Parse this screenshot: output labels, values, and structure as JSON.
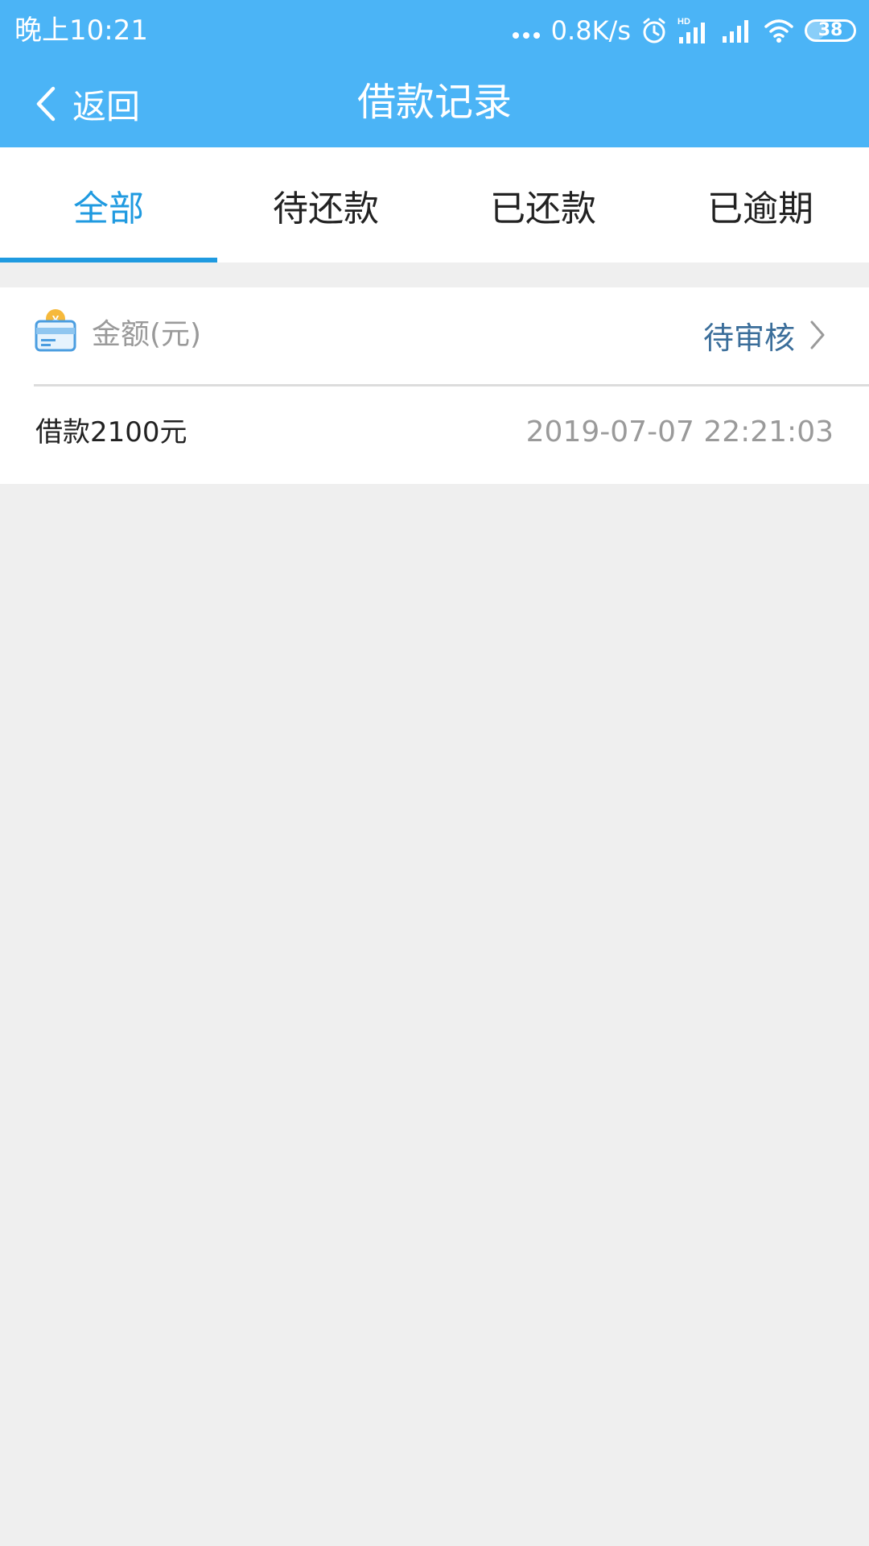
{
  "status_bar": {
    "time": "晚上10:21",
    "net_speed": "0.8K/s",
    "battery": "38",
    "battery_level_percent": 38,
    "icons": [
      "dots-icon",
      "alarm-icon",
      "hd-signal-icon",
      "signal-icon",
      "wifi-icon",
      "battery-icon"
    ]
  },
  "nav": {
    "back_label": "返回",
    "title": "借款记录"
  },
  "tabs": [
    {
      "label": "全部",
      "active": true
    },
    {
      "label": "待还款",
      "active": false
    },
    {
      "label": "已还款",
      "active": false
    },
    {
      "label": "已逾期",
      "active": false
    }
  ],
  "record": {
    "amount_label": "金额(元)",
    "status": "待审核",
    "title": "借款2100元",
    "time": "2019-07-07 22:21:03"
  },
  "colors": {
    "header": "#4bb4f6",
    "accent": "#1f9ae0",
    "status_link": "#3b6e9a",
    "background": "#efefef"
  }
}
